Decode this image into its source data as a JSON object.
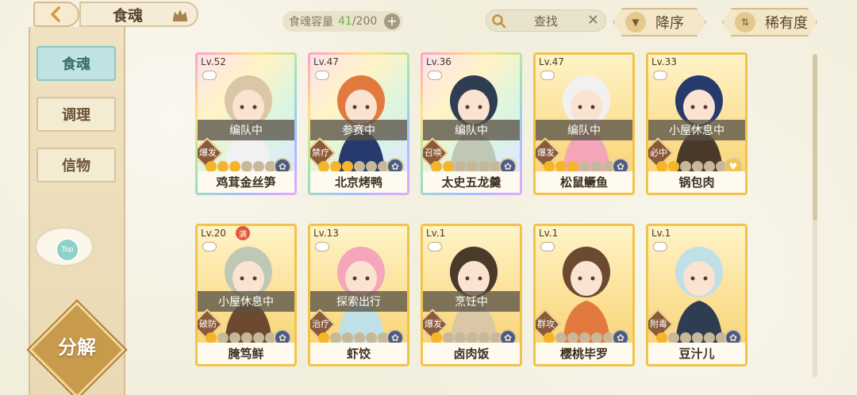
{
  "header": {
    "title": "食魂",
    "capacity_label": "食魂容量",
    "capacity_current": "41",
    "capacity_max": "/200",
    "search_placeholder": "查找",
    "sort_order": "降序",
    "sort_field": "稀有度"
  },
  "sidebar": {
    "items": [
      {
        "label": "食魂"
      },
      {
        "label": "调理"
      },
      {
        "label": "信物"
      }
    ],
    "top_button": "Top",
    "decompose": "分解"
  },
  "cards": [
    {
      "level": "Lv.52",
      "status": "编队中",
      "role": "爆发",
      "stars": 3,
      "name": "鸡茸金丝笋",
      "rainbow": true,
      "emblem": "dark"
    },
    {
      "level": "Lv.47",
      "status": "参赛中",
      "role": "禁疗",
      "stars": 3,
      "name": "北京烤鸭",
      "rainbow": true,
      "emblem": "dark"
    },
    {
      "level": "Lv.36",
      "status": "编队中",
      "role": "召唤",
      "stars": 2,
      "name": "太史五龙羹",
      "rainbow": true,
      "emblem": "dark"
    },
    {
      "level": "Lv.47",
      "status": "编队中",
      "role": "爆发",
      "stars": 3,
      "name": "松鼠鳜鱼",
      "rainbow": false,
      "emblem": "dark"
    },
    {
      "level": "Lv.33",
      "status": "小屋休息中",
      "role": "必中",
      "stars": 2,
      "name": "锅包肉",
      "rainbow": false,
      "emblem": "gold"
    },
    {
      "level": "Lv.20",
      "status": "小屋休息中",
      "role": "破防",
      "stars": 1,
      "name": "腌笃鲜",
      "rainbow": false,
      "emblem": "dark",
      "full_badge": "满"
    },
    {
      "level": "Lv.13",
      "status": "探索出行",
      "role": "治疗",
      "stars": 1,
      "name": "虾饺",
      "rainbow": false,
      "emblem": "dark"
    },
    {
      "level": "Lv.1",
      "status": "烹饪中",
      "role": "爆发",
      "stars": 1,
      "name": "卤肉饭",
      "rainbow": false,
      "emblem": "dark"
    },
    {
      "level": "Lv.1",
      "status": "",
      "role": "群攻",
      "stars": 1,
      "name": "樱桃毕罗",
      "rainbow": false,
      "emblem": "dark"
    },
    {
      "level": "Lv.1",
      "status": "",
      "role": "附毒",
      "stars": 1,
      "name": "豆汁儿",
      "rainbow": false,
      "emblem": "dark"
    }
  ],
  "colors": {
    "background": "#f2eedc",
    "card_gold": "#f0c44a",
    "active_tab": "#bfe3e2",
    "capacity_current": "#6bb24a"
  }
}
